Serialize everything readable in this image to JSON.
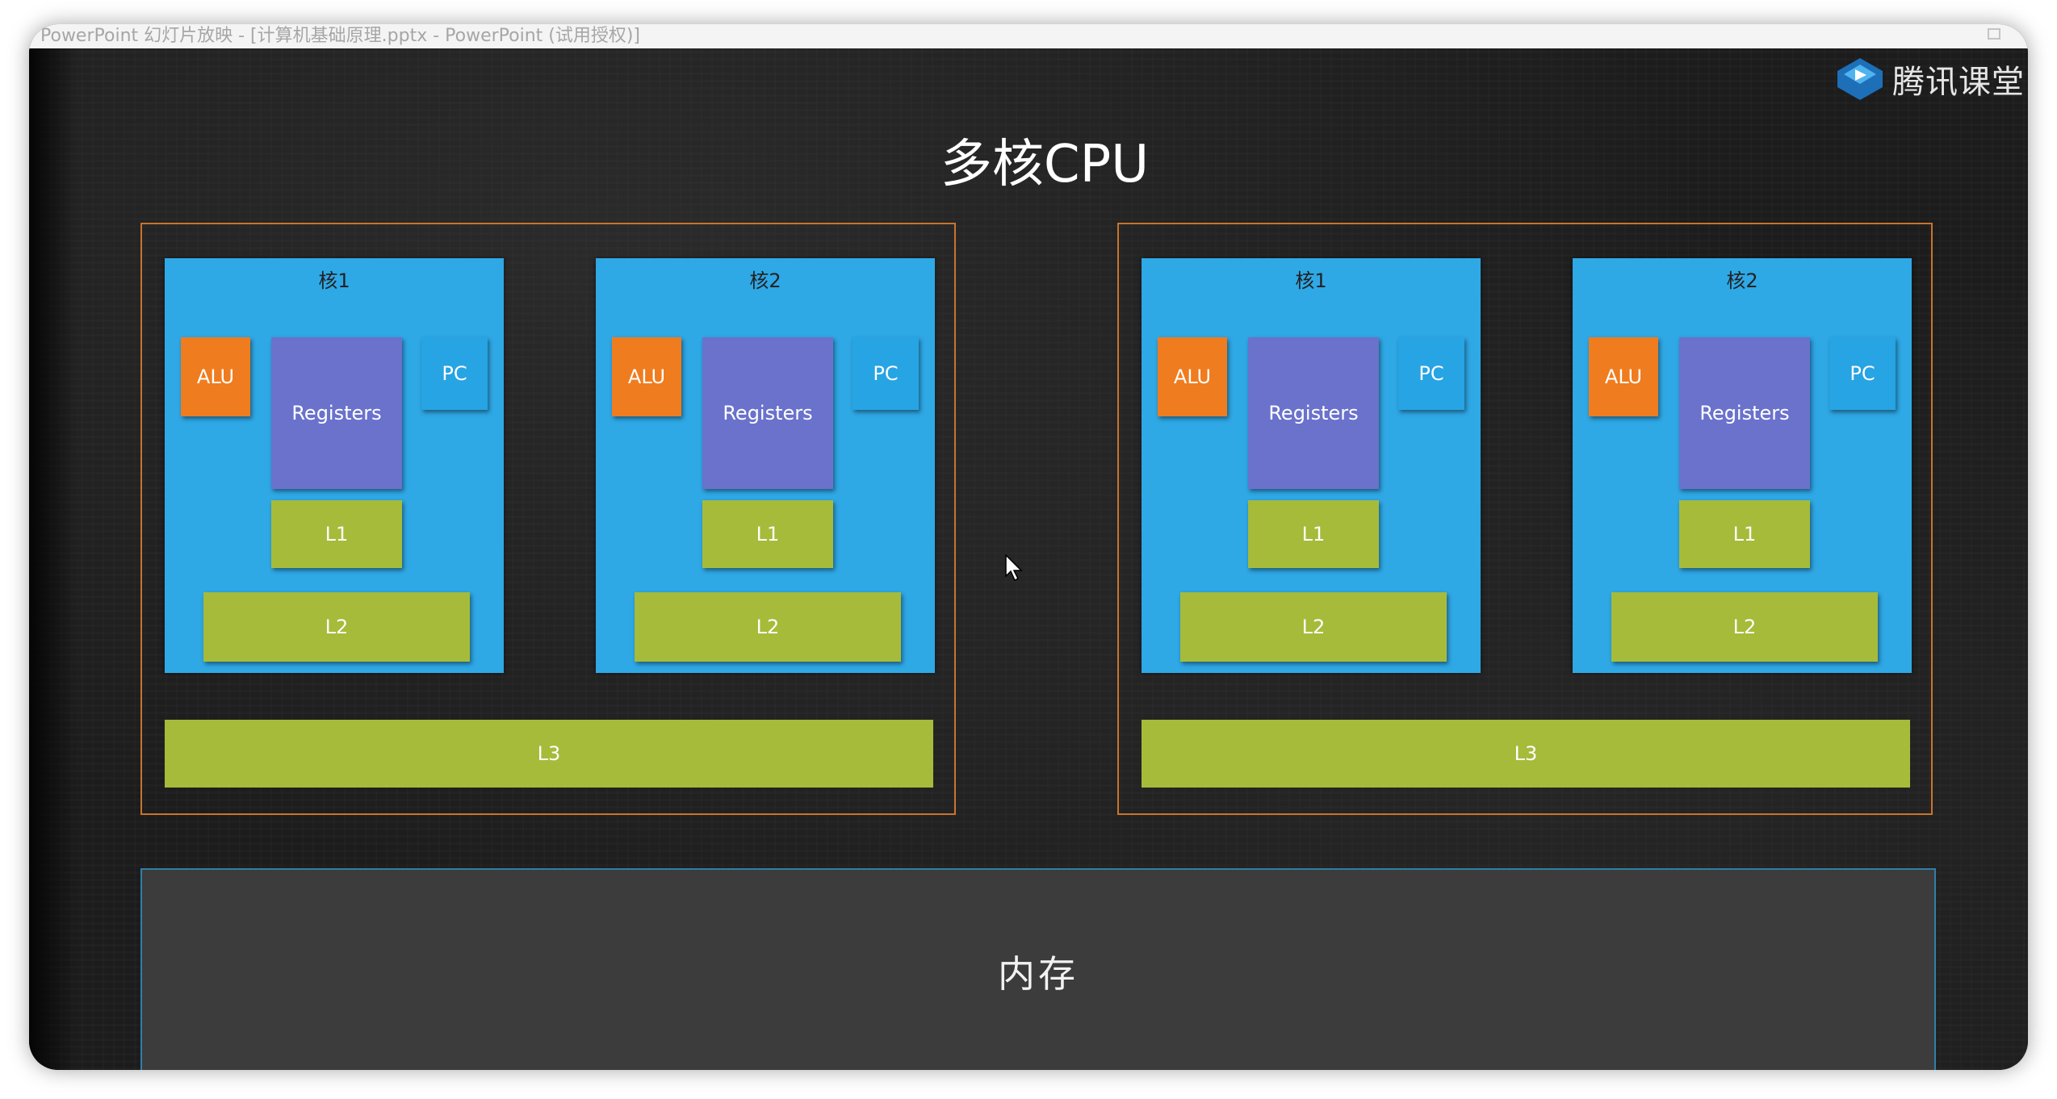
{
  "window": {
    "title_text": "PowerPoint 幻灯片放映 - [计算机基础原理.pptx - PowerPoint (试用授权)]"
  },
  "logo": {
    "text": "腾讯课堂",
    "icon": "tencent-classroom-play-icon"
  },
  "slide": {
    "title": "多核CPU",
    "cpus": [
      {
        "cores": [
          {
            "label": "核1",
            "alu": "ALU",
            "registers": "Registers",
            "pc": "PC",
            "l1": "L1",
            "l2": "L2"
          },
          {
            "label": "核2",
            "alu": "ALU",
            "registers": "Registers",
            "pc": "PC",
            "l1": "L1",
            "l2": "L2"
          }
        ],
        "l3": "L3"
      },
      {
        "cores": [
          {
            "label": "核1",
            "alu": "ALU",
            "registers": "Registers",
            "pc": "PC",
            "l1": "L1",
            "l2": "L2"
          },
          {
            "label": "核2",
            "alu": "ALU",
            "registers": "Registers",
            "pc": "PC",
            "l1": "L1",
            "l2": "L2"
          }
        ],
        "l3": "L3"
      }
    ],
    "memory": "内存"
  },
  "colors": {
    "background": "#1c1c1c",
    "cpu_border": "#c8742e",
    "core": "#2fa8e6",
    "alu": "#ef7c1f",
    "registers": "#6a72cc",
    "pc": "#27a4e3",
    "cache": "#a6bb3a",
    "memory": "#3c3c3c",
    "memory_border": "#2f7fa8"
  }
}
